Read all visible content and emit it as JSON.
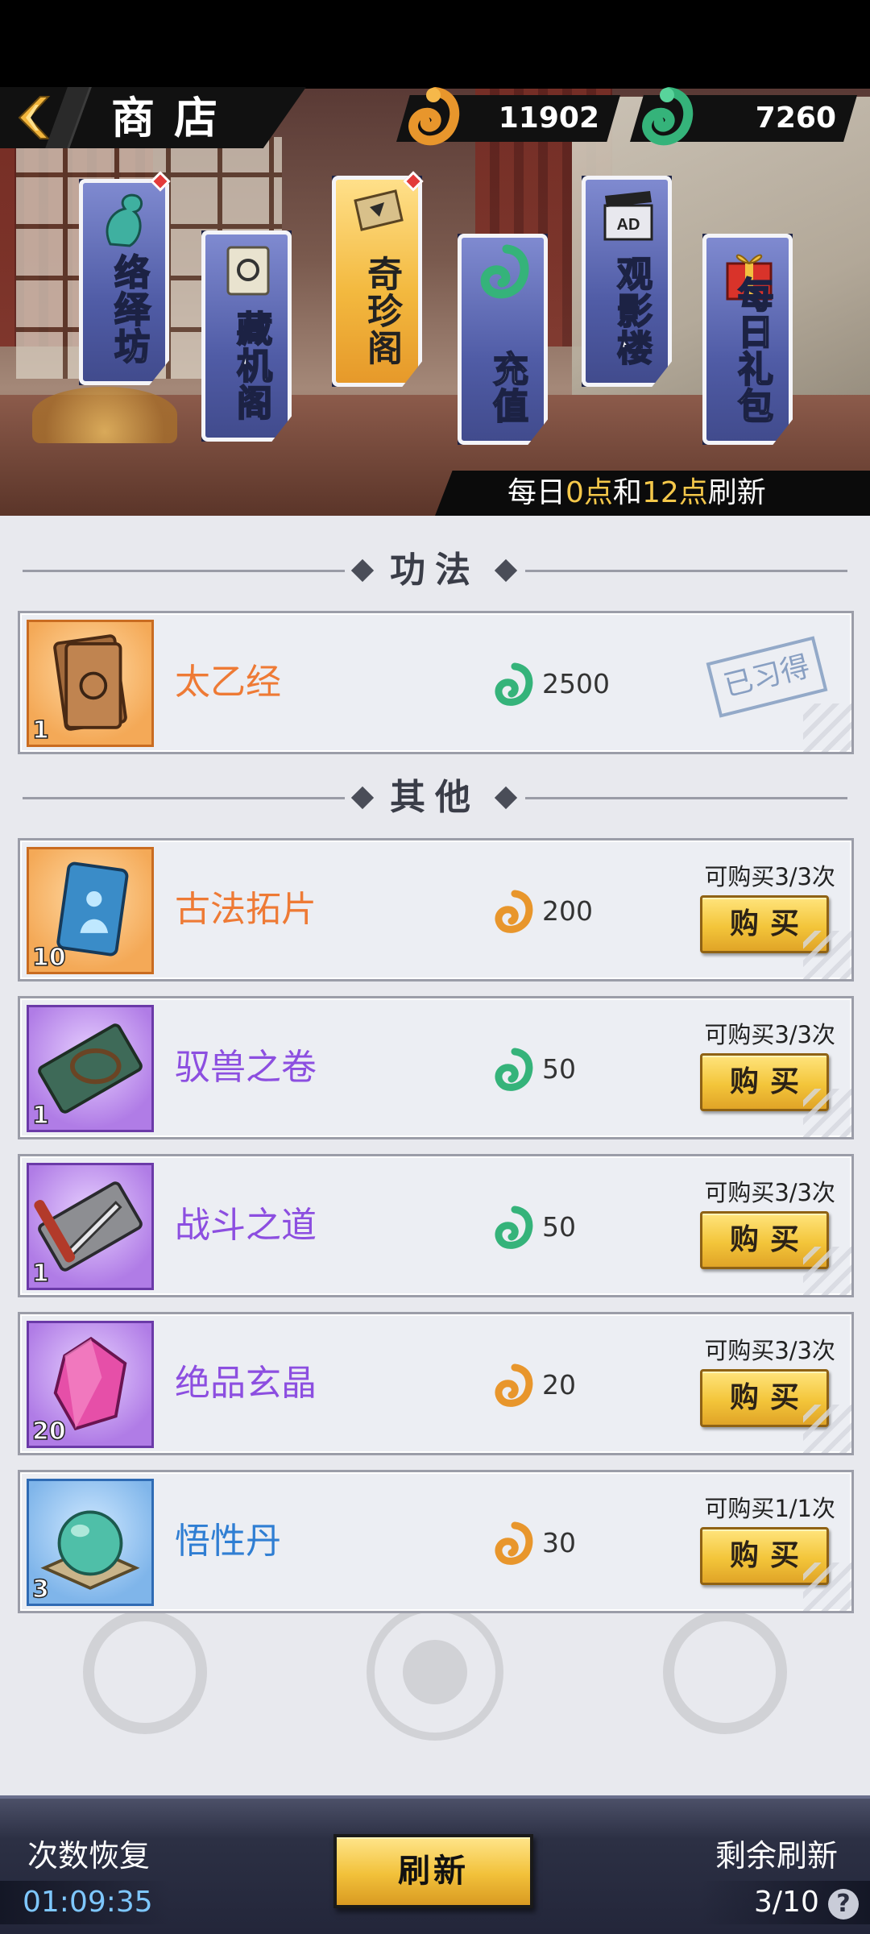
{
  "header": {
    "title": "商店",
    "gold_amount": "11902",
    "jade_amount": "7260"
  },
  "tabs": [
    {
      "label": "络绎坊",
      "active": false,
      "badge": true
    },
    {
      "label": "藏机阁",
      "active": false,
      "badge": false
    },
    {
      "label": "奇珍阁",
      "active": true,
      "badge": true
    },
    {
      "label": "充值",
      "active": false,
      "badge": false
    },
    {
      "label": "观影楼",
      "active": false,
      "badge": false,
      "icon_text": "AD"
    },
    {
      "label": "每日礼包",
      "active": false,
      "badge": false
    }
  ],
  "refresh_note": {
    "prefix": "每日",
    "t1": "0点",
    "mid": "和",
    "t2": "12点",
    "suffix": "刷新"
  },
  "sections": {
    "gongfa": "功法",
    "other": "其他"
  },
  "items": [
    {
      "name": "太乙经",
      "qty": "1",
      "currency": "jade",
      "price": "2500",
      "status": "已习得",
      "rarity": "orange",
      "icon": "book-icon"
    },
    {
      "name": "古法拓片",
      "qty": "10",
      "currency": "gold",
      "price": "200",
      "limit": "可购买3/3次",
      "buy": "购买",
      "rarity": "orange",
      "icon": "rubbing-icon"
    },
    {
      "name": "驭兽之卷",
      "qty": "1",
      "currency": "jade",
      "price": "50",
      "limit": "可购买3/3次",
      "buy": "购买",
      "rarity": "purple",
      "icon": "scroll-whip-icon"
    },
    {
      "name": "战斗之道",
      "qty": "1",
      "currency": "jade",
      "price": "50",
      "limit": "可购买3/3次",
      "buy": "购买",
      "rarity": "purple",
      "icon": "scroll-sword-icon"
    },
    {
      "name": "绝品玄晶",
      "qty": "20",
      "currency": "gold",
      "price": "20",
      "limit": "可购买3/3次",
      "buy": "购买",
      "rarity": "purple",
      "icon": "crystal-icon"
    },
    {
      "name": "悟性丹",
      "qty": "3",
      "currency": "gold",
      "price": "30",
      "limit": "可购买1/1次",
      "buy": "购买",
      "rarity": "blue",
      "icon": "pill-icon"
    }
  ],
  "bottom": {
    "recover_label": "次数恢复",
    "recover_time": "01:09:35",
    "refresh_button": "刷新",
    "remaining_label": "剩余刷新",
    "remaining_count": "3/10",
    "help": "?"
  },
  "colors": {
    "gold_currency": "#f1a63a",
    "jade_currency": "#3fbf86",
    "orange_name": "#ee7a35",
    "purple_name": "#8c4ee0",
    "blue_name": "#2f7ed3"
  }
}
